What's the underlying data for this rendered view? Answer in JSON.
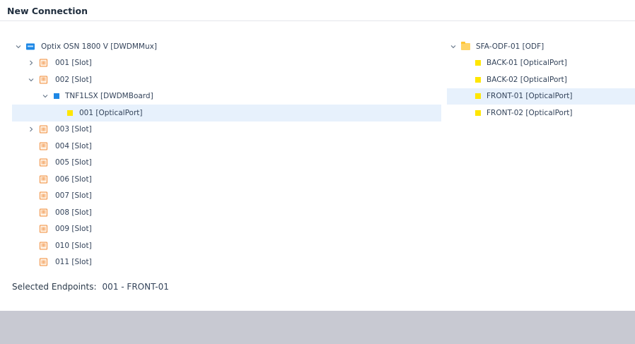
{
  "dialog": {
    "title": "New Connection"
  },
  "left_tree": {
    "root": "Optix OSN 1800 V [DWDMMux]",
    "slot_001": "001 [Slot]",
    "slot_002": "002 [Slot]",
    "board": "TNF1LSX [DWDMBoard]",
    "port_001": "001 [OpticalPort]",
    "slot_003": "003 [Slot]",
    "slot_004": "004 [Slot]",
    "slot_005": "005 [Slot]",
    "slot_006": "006 [Slot]",
    "slot_007": "007 [Slot]",
    "slot_008": "008 [Slot]",
    "slot_009": "009 [Slot]",
    "slot_010": "010 [Slot]",
    "slot_011": "011 [Slot]"
  },
  "right_tree": {
    "root": "SFA-ODF-01 [ODF]",
    "port_back01": "BACK-01 [OpticalPort]",
    "port_back02": "BACK-02 [OpticalPort]",
    "port_front01": "FRONT-01 [OpticalPort]",
    "port_front02": "FRONT-02 [OpticalPort]"
  },
  "footer": {
    "label": "Selected Endpoints:",
    "value": "001 - FRONT-01"
  },
  "colors": {
    "selected_row": "#e7f1fc",
    "port_icon": "#ffe600",
    "slot_icon": "#f08c3a",
    "device_icon": "#1e88e5",
    "bottom_bar": "#c8c9d2"
  }
}
